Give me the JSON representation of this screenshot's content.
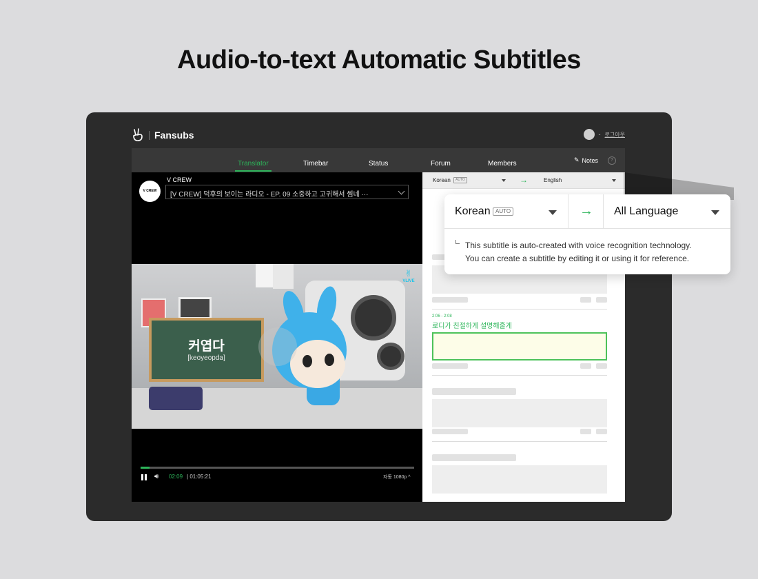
{
  "headline": "Audio-to-text Automatic Subtitles",
  "app": {
    "brand": "Fansubs",
    "logout": "로그아웃",
    "user_dash": "-"
  },
  "tabs": [
    {
      "label": "Translator",
      "active": true
    },
    {
      "label": "Timebar",
      "active": false
    },
    {
      "label": "Status",
      "active": false
    },
    {
      "label": "Forum",
      "active": false
    },
    {
      "label": "Members",
      "active": false
    }
  ],
  "notes_label": "Notes",
  "help_label": "?",
  "video": {
    "channel_logo": "V CREW",
    "channel_name": "V CREW",
    "title": "[V CREW] 덕후의 보이는 라디오 - EP. 09 소중하고 고귀해서 썸네 ···",
    "chalk_word": "커엽다",
    "chalk_romanization": "[keoyeopda]",
    "badge": "VLIVE",
    "current_time": "02:09",
    "total_time": "01:05:21",
    "time_sep": "|",
    "quality": "자동 1080p ^",
    "progress_fraction": 0.033
  },
  "subtitle_panel": {
    "from_lang": "Korean",
    "auto_badge": "AUTO",
    "to_lang": "English",
    "arrow": "→",
    "cue_time": "2:06 - 2:08",
    "cue_text": "로디가 친절하게 설명해줄게"
  },
  "callout": {
    "from_lang": "Korean",
    "auto_badge": "AUTO",
    "arrow": "→",
    "to_lang": "All Language",
    "line1": "This subtitle is auto-created with voice recognition technology.",
    "line2": "You can create a subtitle by editing it or using it for reference."
  },
  "colors": {
    "accent_green": "#2db55a",
    "device_bg": "#2b2b2b",
    "page_bg": "#dcdcde"
  }
}
